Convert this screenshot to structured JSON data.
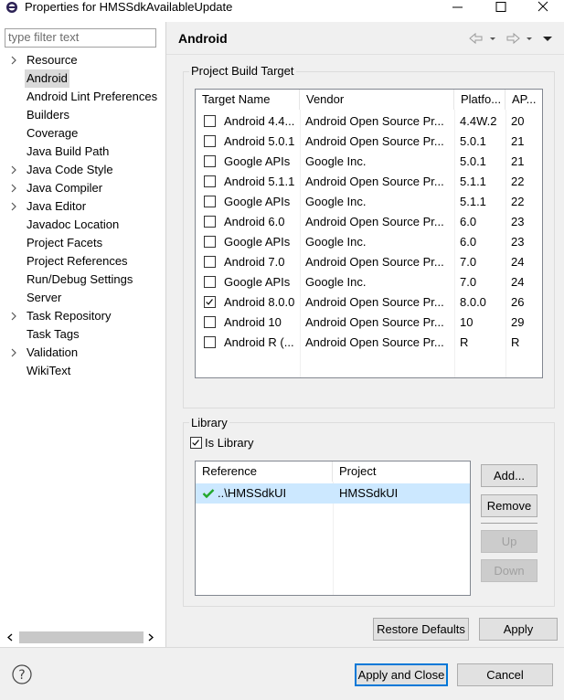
{
  "window": {
    "title": "Properties for HMSSdkAvailableUpdate",
    "minimize_icon": "minimize-icon",
    "maximize_icon": "maximize-icon",
    "close_icon": "close-icon"
  },
  "filter": {
    "placeholder": "type filter text"
  },
  "tree": [
    {
      "label": "Resource",
      "expandable": true
    },
    {
      "label": "Android",
      "expandable": false,
      "selected": true
    },
    {
      "label": "Android Lint Preferences",
      "expandable": false
    },
    {
      "label": "Builders",
      "expandable": false
    },
    {
      "label": "Coverage",
      "expandable": false
    },
    {
      "label": "Java Build Path",
      "expandable": false
    },
    {
      "label": "Java Code Style",
      "expandable": true
    },
    {
      "label": "Java Compiler",
      "expandable": true
    },
    {
      "label": "Java Editor",
      "expandable": true
    },
    {
      "label": "Javadoc Location",
      "expandable": false
    },
    {
      "label": "Project Facets",
      "expandable": false
    },
    {
      "label": "Project References",
      "expandable": false
    },
    {
      "label": "Run/Debug Settings",
      "expandable": false
    },
    {
      "label": "Server",
      "expandable": false
    },
    {
      "label": "Task Repository",
      "expandable": true
    },
    {
      "label": "Task Tags",
      "expandable": false
    },
    {
      "label": "Validation",
      "expandable": true
    },
    {
      "label": "WikiText",
      "expandable": false
    }
  ],
  "page": {
    "title": "Android"
  },
  "build_target": {
    "group_label": "Project Build Target",
    "columns": [
      "Target Name",
      "Vendor",
      "Platfo...",
      "AP..."
    ],
    "rows": [
      {
        "name": "Android 4.4...",
        "vendor": "Android Open Source Pr...",
        "platform": "4.4W.2",
        "api": "20",
        "checked": false
      },
      {
        "name": "Android 5.0.1",
        "vendor": "Android Open Source Pr...",
        "platform": "5.0.1",
        "api": "21",
        "checked": false
      },
      {
        "name": "Google APIs",
        "vendor": "Google Inc.",
        "platform": "5.0.1",
        "api": "21",
        "checked": false
      },
      {
        "name": "Android 5.1.1",
        "vendor": "Android Open Source Pr...",
        "platform": "5.1.1",
        "api": "22",
        "checked": false
      },
      {
        "name": "Google APIs",
        "vendor": "Google Inc.",
        "platform": "5.1.1",
        "api": "22",
        "checked": false
      },
      {
        "name": "Android 6.0",
        "vendor": "Android Open Source Pr...",
        "platform": "6.0",
        "api": "23",
        "checked": false
      },
      {
        "name": "Google APIs",
        "vendor": "Google Inc.",
        "platform": "6.0",
        "api": "23",
        "checked": false
      },
      {
        "name": "Android 7.0",
        "vendor": "Android Open Source Pr...",
        "platform": "7.0",
        "api": "24",
        "checked": false
      },
      {
        "name": "Google APIs",
        "vendor": "Google Inc.",
        "platform": "7.0",
        "api": "24",
        "checked": false
      },
      {
        "name": "Android 8.0.0",
        "vendor": "Android Open Source Pr...",
        "platform": "8.0.0",
        "api": "26",
        "checked": true
      },
      {
        "name": "Android 10",
        "vendor": "Android Open Source Pr...",
        "platform": "10",
        "api": "29",
        "checked": false
      },
      {
        "name": "Android R (...",
        "vendor": "Android Open Source Pr...",
        "platform": "R",
        "api": "R",
        "checked": false
      }
    ]
  },
  "library": {
    "group_label": "Library",
    "is_library_label": "Is Library",
    "is_library": true,
    "columns": [
      "Reference",
      "Project"
    ],
    "rows": [
      {
        "reference": "..\\HMSSdkUI",
        "project": "HMSSdkUI",
        "status_icon": "checkmark-icon"
      }
    ],
    "buttons": {
      "add": "Add...",
      "remove": "Remove",
      "up": "Up",
      "down": "Down"
    }
  },
  "page_buttons": {
    "restore": "Restore Defaults",
    "apply": "Apply"
  },
  "dialog_buttons": {
    "apply_close": "Apply and Close",
    "cancel": "Cancel",
    "help_icon": "help-icon"
  },
  "colors": {
    "accent": "#0078d7",
    "check_green": "#22a82a",
    "selection_row": "#cce8ff"
  }
}
